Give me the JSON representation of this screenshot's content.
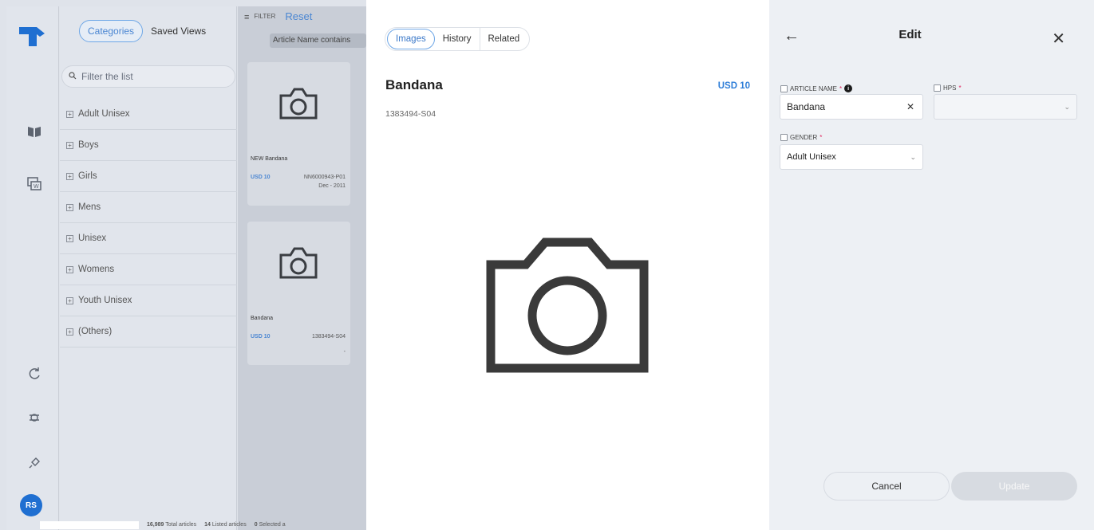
{
  "app": {
    "segments": {
      "categories": "Categories",
      "saved_views": "Saved Views"
    },
    "filter_placeholder": "Filter the list",
    "categories": [
      "Adult Unisex",
      "Boys",
      "Girls",
      "Mens",
      "Unisex",
      "Womens",
      "Youth Unisex",
      "(Others)"
    ],
    "filter_label": "FILTER",
    "reset_label": "Reset",
    "filter_chip": "Article Name contains",
    "cards": [
      {
        "name": "NEW Bandana",
        "price": "USD 10",
        "code": "NN6000943-P01",
        "extra": "Dec - 2011"
      },
      {
        "name": "Bandana",
        "price": "USD 10",
        "code": "1383494-S04",
        "extra": "-"
      }
    ],
    "status": {
      "total_count": "16,989",
      "total_label": "Total articles",
      "listed_count": "14",
      "listed_label": "Listed articles",
      "selected_count": "0",
      "selected_label": "Selected a"
    },
    "avatar_initials": "RS"
  },
  "detail": {
    "tabs": [
      "Images",
      "History",
      "Related"
    ],
    "active_tab": "Images",
    "title": "Bandana",
    "price": "USD 10",
    "code": "1383494-S04"
  },
  "edit": {
    "title": "Edit",
    "article_name_label": "ARTICLE NAME",
    "article_name_value": "Bandana",
    "hps_label": "HPS",
    "hps_value": "",
    "gender_label": "GENDER",
    "gender_value": "Adult Unisex",
    "required_mark": "*",
    "cancel_label": "Cancel",
    "update_label": "Update"
  },
  "icons": {
    "back": "arrow-left-icon",
    "close": "close-icon",
    "image_placeholder": "camera-icon",
    "info": "info-icon"
  },
  "colors": {
    "accent": "#2f7ed8",
    "required": "#e0245e",
    "avatar": "#1f6fd1"
  }
}
